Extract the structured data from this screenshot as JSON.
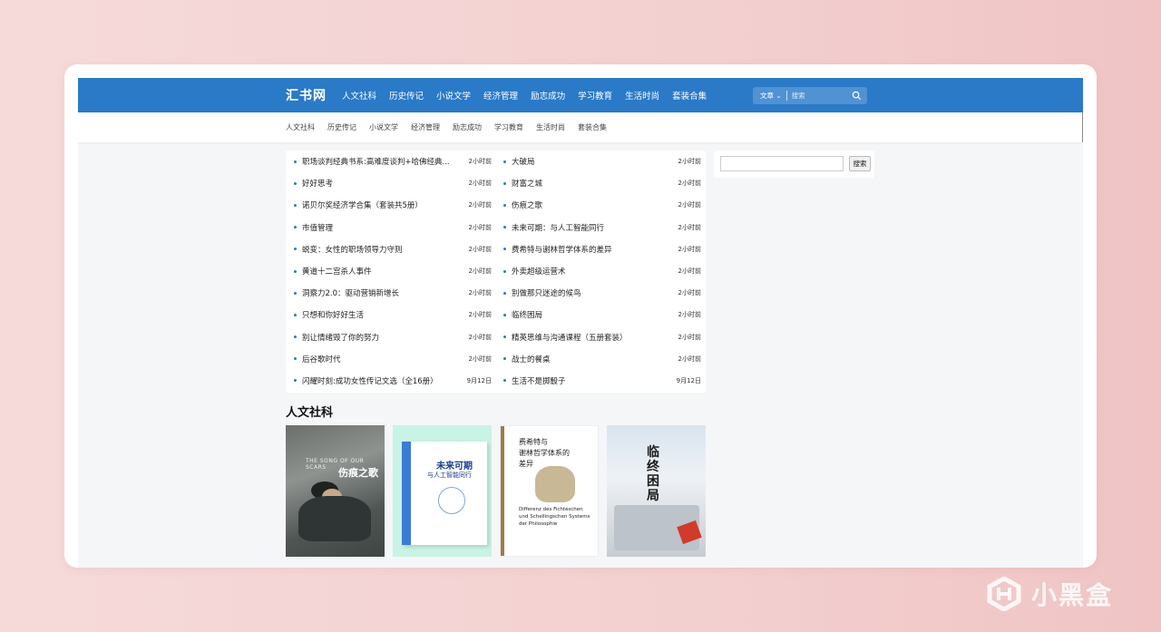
{
  "site": {
    "logo": "汇书网",
    "main_nav": [
      "人文社科",
      "历史传记",
      "小说文学",
      "经济管理",
      "励志成功",
      "学习教育",
      "生活时尚",
      "套装合集"
    ],
    "sub_nav": [
      "人文社科",
      "历史传记",
      "小说文学",
      "经济管理",
      "励志成功",
      "学习教育",
      "生活时尚",
      "套装合集"
    ],
    "search": {
      "type_label": "文章 ⌄",
      "placeholder": "搜索"
    }
  },
  "articles_left": [
    {
      "title": "职场谈判经典书系:高难度谈判+哈佛经典...",
      "date": "2小时前"
    },
    {
      "title": "好好思考",
      "date": "2小时前"
    },
    {
      "title": "诺贝尔奖经济学合集（套装共5册）",
      "date": "2小时前"
    },
    {
      "title": "市值管理",
      "date": "2小时前"
    },
    {
      "title": "蜕变：女性的职场领导力守则",
      "date": "2小时前"
    },
    {
      "title": "黄道十二宫杀人事件",
      "date": "2小时前"
    },
    {
      "title": "洞察力2.0：驱动营销新增长",
      "date": "2小时前"
    },
    {
      "title": "只想和你好好生活",
      "date": "2小时前"
    },
    {
      "title": "别让情绪毁了你的努力",
      "date": "2小时前"
    },
    {
      "title": "后谷歌时代",
      "date": "2小时前"
    },
    {
      "title": "闪耀时刻:成功女性传记文选（全16册）",
      "date": "9月12日"
    }
  ],
  "articles_right": [
    {
      "title": "大破局",
      "date": "2小时前"
    },
    {
      "title": "财富之城",
      "date": "2小时前"
    },
    {
      "title": "伤痕之歌",
      "date": "2小时前"
    },
    {
      "title": "未来可期：与人工智能同行",
      "date": "2小时前"
    },
    {
      "title": "费希特与谢林哲学体系的差异",
      "date": "2小时前"
    },
    {
      "title": "外卖超级运营术",
      "date": "2小时前"
    },
    {
      "title": "别做那只迷途的候鸟",
      "date": "2小时前"
    },
    {
      "title": "临终困局",
      "date": "2小时前"
    },
    {
      "title": "精英思维与沟通课程（五册套装）",
      "date": "2小时前"
    },
    {
      "title": "战士的餐桌",
      "date": "2小时前"
    },
    {
      "title": "生活不是掷骰子",
      "date": "9月12日"
    }
  ],
  "sidebar": {
    "search_button": "搜索"
  },
  "section": {
    "title": "人文社科",
    "books": [
      {
        "cover_en": "THE SONG OF OUR SCARS",
        "cover_cn": "伤痕之歌"
      },
      {
        "cover_t1": "未来可期",
        "cover_t2": "与人工智能同行"
      },
      {
        "cover_t1": "费希特与\n谢林哲学体系的\n差异",
        "cover_de": "Differenz des Fichteschen\nund Schellingschen Systems\nder Philosophie"
      },
      {
        "cover_t1": "临终困局"
      }
    ]
  },
  "watermark": {
    "text": "小黑盒"
  },
  "colors": {
    "primary": "#2a7ac8",
    "background": "#f5f6f8"
  }
}
